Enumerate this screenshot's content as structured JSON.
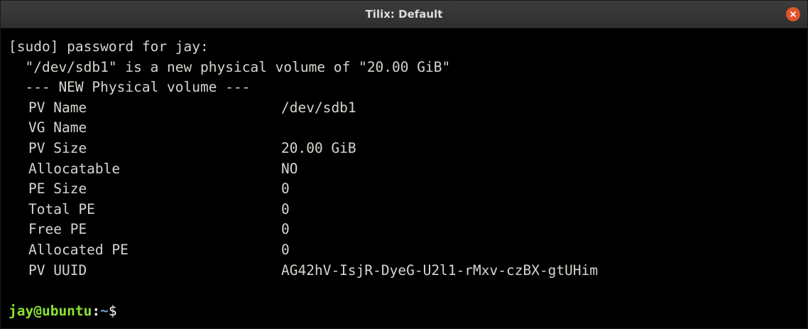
{
  "window": {
    "title": "Tilix: Default"
  },
  "terminal": {
    "lines": [
      "[sudo] password for jay:",
      "  \"/dev/sdb1\" is a new physical volume of \"20.00 GiB\"",
      "  --- NEW Physical volume ---"
    ],
    "fields": [
      {
        "key": "PV Name",
        "value": "/dev/sdb1"
      },
      {
        "key": "VG Name",
        "value": ""
      },
      {
        "key": "PV Size",
        "value": "20.00 GiB"
      },
      {
        "key": "Allocatable",
        "value": "NO"
      },
      {
        "key": "PE Size",
        "value": "0"
      },
      {
        "key": "Total PE",
        "value": "0"
      },
      {
        "key": "Free PE",
        "value": "0"
      },
      {
        "key": "Allocated PE",
        "value": "0"
      },
      {
        "key": "PV UUID",
        "value": "AG42hV-IsjR-DyeG-U2l1-rMxv-czBX-gtUHim"
      }
    ],
    "prompt": {
      "user_host": "jay@ubuntu",
      "colon": ":",
      "path": "~",
      "symbol": "$"
    }
  }
}
